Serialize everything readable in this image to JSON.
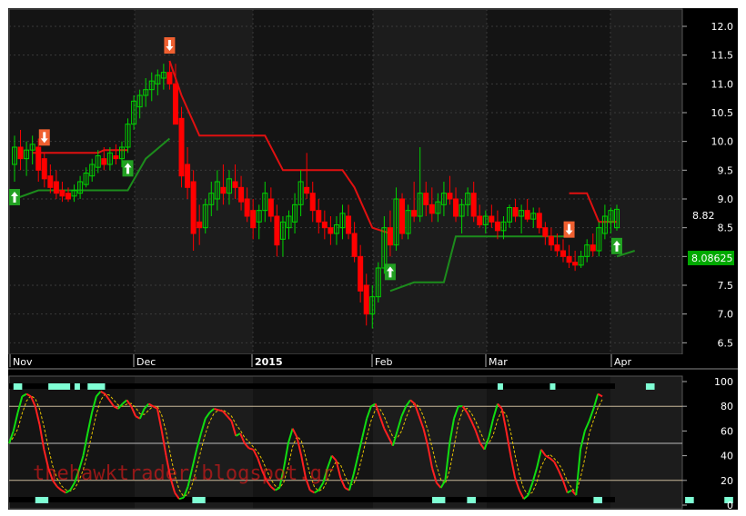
{
  "colors": {
    "background": "#000000",
    "panel_bg_dark": "#141414",
    "panel_bg_light": "#1c1c1c",
    "grid": "#3a3a3a",
    "bull": "#00d400",
    "bear": "#ff0000",
    "stop_up": "#1c8c1c",
    "stop_down": "#e01010",
    "axis_text": "#ffffff",
    "last_price_box": "#00a800",
    "buy_marker": "#22a022",
    "sell_marker": "#f06030",
    "stoch_k_up": "#11dd11",
    "stoch_k_down": "#ff2020",
    "stoch_d": "#e6c200",
    "band_level": "#c8b89a",
    "cyan_marker": "#7fffd4",
    "watermark": "#ff1a1a"
  },
  "x_labels": [
    "Nov",
    "Dec",
    "2015",
    "Feb",
    "Mar",
    "Apr"
  ],
  "watermark_text": "thehawktrader.blogspot.gr",
  "chart_data": [
    {
      "type": "candlestick",
      "title": "",
      "x_range": [
        "Nov 2014",
        "Apr 2015"
      ],
      "y_ticks": [
        6.5,
        7.0,
        7.5,
        8.0,
        8.5,
        9.0,
        9.5,
        10.0,
        10.5,
        11.0,
        11.5,
        12.0
      ],
      "ylim": [
        6.3,
        12.3
      ],
      "last_price": "8.08625",
      "last_high_label": "8.82",
      "grid": true,
      "candles": [
        {
          "o": 9.6,
          "h": 10.1,
          "l": 9.3,
          "c": 9.9
        },
        {
          "o": 9.9,
          "h": 10.2,
          "l": 9.5,
          "c": 9.7
        },
        {
          "o": 9.7,
          "h": 10.0,
          "l": 9.4,
          "c": 9.85
        },
        {
          "o": 9.85,
          "h": 10.1,
          "l": 9.6,
          "c": 9.95
        },
        {
          "o": 9.9,
          "h": 10.05,
          "l": 9.3,
          "c": 9.5
        },
        {
          "o": 9.7,
          "h": 9.8,
          "l": 9.2,
          "c": 9.35
        },
        {
          "o": 9.4,
          "h": 9.6,
          "l": 9.1,
          "c": 9.2
        },
        {
          "o": 9.3,
          "h": 9.5,
          "l": 9.0,
          "c": 9.1
        },
        {
          "o": 9.15,
          "h": 9.3,
          "l": 8.95,
          "c": 9.05
        },
        {
          "o": 9.1,
          "h": 9.2,
          "l": 8.95,
          "c": 9.0
        },
        {
          "o": 9.05,
          "h": 9.25,
          "l": 8.95,
          "c": 9.15
        },
        {
          "o": 9.1,
          "h": 9.4,
          "l": 9.0,
          "c": 9.3
        },
        {
          "o": 9.25,
          "h": 9.55,
          "l": 9.2,
          "c": 9.45
        },
        {
          "o": 9.4,
          "h": 9.7,
          "l": 9.3,
          "c": 9.6
        },
        {
          "o": 9.55,
          "h": 9.85,
          "l": 9.45,
          "c": 9.75
        },
        {
          "o": 9.7,
          "h": 9.9,
          "l": 9.5,
          "c": 9.6
        },
        {
          "o": 9.6,
          "h": 9.9,
          "l": 9.5,
          "c": 9.8
        },
        {
          "o": 9.75,
          "h": 9.95,
          "l": 9.6,
          "c": 9.7
        },
        {
          "o": 9.7,
          "h": 10.0,
          "l": 9.55,
          "c": 9.9
        },
        {
          "o": 9.9,
          "h": 10.4,
          "l": 9.8,
          "c": 10.3
        },
        {
          "o": 10.3,
          "h": 10.8,
          "l": 10.2,
          "c": 10.7
        },
        {
          "o": 10.6,
          "h": 10.9,
          "l": 10.4,
          "c": 10.8
        },
        {
          "o": 10.8,
          "h": 11.1,
          "l": 10.6,
          "c": 10.9
        },
        {
          "o": 10.9,
          "h": 11.2,
          "l": 10.7,
          "c": 11.05
        },
        {
          "o": 11.0,
          "h": 11.25,
          "l": 10.8,
          "c": 11.15
        },
        {
          "o": 11.1,
          "h": 11.35,
          "l": 10.9,
          "c": 11.2
        },
        {
          "o": 11.2,
          "h": 11.4,
          "l": 10.9,
          "c": 11.0
        },
        {
          "o": 11.0,
          "h": 11.35,
          "l": 10.6,
          "c": 10.3
        },
        {
          "o": 10.4,
          "h": 10.6,
          "l": 9.2,
          "c": 9.4
        },
        {
          "o": 9.6,
          "h": 9.9,
          "l": 9.0,
          "c": 9.2
        },
        {
          "o": 9.3,
          "h": 9.5,
          "l": 8.1,
          "c": 8.4
        },
        {
          "o": 8.6,
          "h": 8.9,
          "l": 8.2,
          "c": 8.5
        },
        {
          "o": 8.5,
          "h": 9.0,
          "l": 8.4,
          "c": 8.9
        },
        {
          "o": 8.9,
          "h": 9.3,
          "l": 8.7,
          "c": 9.1
        },
        {
          "o": 9.0,
          "h": 9.5,
          "l": 8.8,
          "c": 9.3
        },
        {
          "o": 9.2,
          "h": 9.6,
          "l": 8.9,
          "c": 9.1
        },
        {
          "o": 9.1,
          "h": 9.5,
          "l": 8.9,
          "c": 9.35
        },
        {
          "o": 9.3,
          "h": 9.6,
          "l": 9.0,
          "c": 9.2
        },
        {
          "o": 9.2,
          "h": 9.4,
          "l": 8.8,
          "c": 8.95
        },
        {
          "o": 9.0,
          "h": 9.2,
          "l": 8.6,
          "c": 8.7
        },
        {
          "o": 8.8,
          "h": 9.0,
          "l": 8.3,
          "c": 8.5
        },
        {
          "o": 8.6,
          "h": 8.9,
          "l": 8.3,
          "c": 8.8
        },
        {
          "o": 8.8,
          "h": 9.3,
          "l": 8.6,
          "c": 9.1
        },
        {
          "o": 9.0,
          "h": 9.2,
          "l": 8.6,
          "c": 8.7
        },
        {
          "o": 8.7,
          "h": 8.9,
          "l": 8.0,
          "c": 8.2
        },
        {
          "o": 8.3,
          "h": 8.7,
          "l": 8.0,
          "c": 8.6
        },
        {
          "o": 8.5,
          "h": 8.8,
          "l": 8.3,
          "c": 8.7
        },
        {
          "o": 8.6,
          "h": 9.1,
          "l": 8.4,
          "c": 8.9
        },
        {
          "o": 8.9,
          "h": 9.5,
          "l": 8.7,
          "c": 9.3
        },
        {
          "o": 9.2,
          "h": 9.8,
          "l": 9.0,
          "c": 9.1
        },
        {
          "o": 9.1,
          "h": 9.3,
          "l": 8.6,
          "c": 8.8
        },
        {
          "o": 8.8,
          "h": 9.0,
          "l": 8.4,
          "c": 8.6
        },
        {
          "o": 8.6,
          "h": 8.8,
          "l": 8.3,
          "c": 8.5
        },
        {
          "o": 8.5,
          "h": 8.7,
          "l": 8.2,
          "c": 8.4
        },
        {
          "o": 8.4,
          "h": 8.7,
          "l": 8.2,
          "c": 8.55
        },
        {
          "o": 8.5,
          "h": 8.9,
          "l": 8.3,
          "c": 8.75
        },
        {
          "o": 8.7,
          "h": 8.9,
          "l": 8.3,
          "c": 8.4
        },
        {
          "o": 8.4,
          "h": 8.6,
          "l": 7.9,
          "c": 8.0
        },
        {
          "o": 8.0,
          "h": 8.2,
          "l": 7.2,
          "c": 7.4
        },
        {
          "o": 7.5,
          "h": 7.7,
          "l": 6.8,
          "c": 7.0
        },
        {
          "o": 7.0,
          "h": 7.5,
          "l": 6.75,
          "c": 7.3
        },
        {
          "o": 7.3,
          "h": 7.9,
          "l": 7.2,
          "c": 7.8
        },
        {
          "o": 7.8,
          "h": 8.7,
          "l": 7.7,
          "c": 8.5
        },
        {
          "o": 8.5,
          "h": 8.8,
          "l": 8.0,
          "c": 8.2
        },
        {
          "o": 8.2,
          "h": 9.2,
          "l": 8.1,
          "c": 9.0
        },
        {
          "o": 9.0,
          "h": 9.1,
          "l": 8.3,
          "c": 8.4
        },
        {
          "o": 8.4,
          "h": 8.9,
          "l": 8.3,
          "c": 8.8
        },
        {
          "o": 8.8,
          "h": 9.3,
          "l": 8.6,
          "c": 8.7
        },
        {
          "o": 8.7,
          "h": 9.9,
          "l": 8.6,
          "c": 9.1
        },
        {
          "o": 9.1,
          "h": 9.3,
          "l": 8.7,
          "c": 8.9
        },
        {
          "o": 8.9,
          "h": 9.2,
          "l": 8.6,
          "c": 8.75
        },
        {
          "o": 8.75,
          "h": 9.1,
          "l": 8.6,
          "c": 8.95
        },
        {
          "o": 8.9,
          "h": 9.3,
          "l": 8.7,
          "c": 9.1
        },
        {
          "o": 9.1,
          "h": 9.4,
          "l": 8.9,
          "c": 9.0
        },
        {
          "o": 9.0,
          "h": 9.2,
          "l": 8.6,
          "c": 8.7
        },
        {
          "o": 8.7,
          "h": 9.0,
          "l": 8.4,
          "c": 8.9
        },
        {
          "o": 8.9,
          "h": 9.2,
          "l": 8.7,
          "c": 9.1
        },
        {
          "o": 9.1,
          "h": 9.3,
          "l": 8.6,
          "c": 8.7
        },
        {
          "o": 8.7,
          "h": 8.9,
          "l": 8.5,
          "c": 8.55
        },
        {
          "o": 8.55,
          "h": 8.8,
          "l": 8.4,
          "c": 8.7
        },
        {
          "o": 8.7,
          "h": 8.9,
          "l": 8.5,
          "c": 8.6
        },
        {
          "o": 8.6,
          "h": 8.8,
          "l": 8.3,
          "c": 8.45
        },
        {
          "o": 8.45,
          "h": 8.7,
          "l": 8.3,
          "c": 8.6
        },
        {
          "o": 8.6,
          "h": 8.9,
          "l": 8.5,
          "c": 8.85
        },
        {
          "o": 8.85,
          "h": 9.0,
          "l": 8.6,
          "c": 8.7
        },
        {
          "o": 8.7,
          "h": 8.9,
          "l": 8.4,
          "c": 8.8
        },
        {
          "o": 8.8,
          "h": 9.0,
          "l": 8.6,
          "c": 8.65
        },
        {
          "o": 8.65,
          "h": 8.85,
          "l": 8.5,
          "c": 8.75
        },
        {
          "o": 8.75,
          "h": 8.85,
          "l": 8.4,
          "c": 8.5
        },
        {
          "o": 8.5,
          "h": 8.6,
          "l": 8.2,
          "c": 8.35
        },
        {
          "o": 8.35,
          "h": 8.5,
          "l": 8.1,
          "c": 8.2
        },
        {
          "o": 8.2,
          "h": 8.4,
          "l": 8.0,
          "c": 8.1
        },
        {
          "o": 8.1,
          "h": 8.3,
          "l": 7.9,
          "c": 8.0
        },
        {
          "o": 8.0,
          "h": 8.2,
          "l": 7.8,
          "c": 7.9
        },
        {
          "o": 7.9,
          "h": 8.1,
          "l": 7.75,
          "c": 7.85
        },
        {
          "o": 7.85,
          "h": 8.1,
          "l": 7.8,
          "c": 8.0
        },
        {
          "o": 8.0,
          "h": 8.3,
          "l": 7.9,
          "c": 8.2
        },
        {
          "o": 8.2,
          "h": 8.4,
          "l": 8.0,
          "c": 8.1
        },
        {
          "o": 8.1,
          "h": 8.6,
          "l": 8.0,
          "c": 8.5
        },
        {
          "o": 8.4,
          "h": 8.9,
          "l": 8.3,
          "c": 8.7
        },
        {
          "o": 8.6,
          "h": 8.85,
          "l": 8.4,
          "c": 8.8
        },
        {
          "o": 8.5,
          "h": 8.9,
          "l": 8.45,
          "c": 8.82
        }
      ],
      "stop_segments": [
        {
          "dir": "up",
          "points": [
            [
              0,
              9.0
            ],
            [
              4,
              9.15
            ],
            [
              19,
              9.15
            ],
            [
              22,
              9.7
            ],
            [
              26,
              10.05
            ]
          ]
        },
        {
          "dir": "down",
          "points": [
            [
              3,
              9.8
            ],
            [
              14,
              9.8
            ],
            [
              15,
              9.85
            ],
            [
              19,
              9.85
            ]
          ]
        },
        {
          "dir": "down",
          "points": [
            [
              26,
              11.4
            ],
            [
              28,
              10.8
            ],
            [
              31,
              10.1
            ],
            [
              42,
              10.1
            ],
            [
              45,
              9.5
            ],
            [
              55,
              9.5
            ],
            [
              57,
              9.2
            ],
            [
              60,
              8.5
            ],
            [
              63,
              8.4
            ]
          ]
        },
        {
          "dir": "up",
          "points": [
            [
              63,
              7.4
            ],
            [
              67,
              7.55
            ],
            [
              72,
              7.55
            ],
            [
              74,
              8.35
            ],
            [
              93,
              8.35
            ]
          ]
        },
        {
          "dir": "down",
          "points": [
            [
              93,
              9.1
            ],
            [
              96,
              9.1
            ],
            [
              98,
              8.6
            ],
            [
              101,
              8.6
            ]
          ]
        },
        {
          "dir": "up",
          "points": [
            [
              101,
              8.0
            ],
            [
              104,
              8.1
            ]
          ]
        }
      ],
      "buy_signals": [
        0,
        19,
        63,
        101
      ],
      "sell_signals": [
        5,
        26,
        93
      ]
    },
    {
      "type": "line",
      "title": "",
      "y_ticks": [
        0,
        20,
        40,
        60,
        80,
        100
      ],
      "ylim": [
        0,
        100
      ],
      "levels": [
        20,
        50,
        80
      ],
      "series": [
        {
          "values": [
            50,
            60,
            75,
            88,
            90,
            88,
            80,
            65,
            45,
            30,
            20,
            15,
            12,
            10,
            12,
            18,
            28,
            40,
            58,
            75,
            88,
            92,
            90,
            85,
            80,
            78,
            82,
            85,
            80,
            72,
            70,
            78,
            82,
            80,
            78,
            60,
            40,
            22,
            10,
            5,
            6,
            15,
            30,
            45,
            58,
            70,
            75,
            78,
            77,
            76,
            72,
            68,
            56,
            58,
            50,
            46,
            45,
            38,
            28,
            20,
            15,
            12,
            14,
            30,
            50,
            62,
            55,
            40,
            22,
            12,
            10,
            12,
            18,
            30,
            40,
            36,
            22,
            14,
            12,
            25,
            40,
            55,
            70,
            80,
            82,
            72,
            62,
            55,
            48,
            60,
            72,
            80,
            85,
            82,
            72,
            62,
            48,
            30,
            18,
            14,
            20,
            50,
            70,
            80,
            80,
            75,
            68,
            60,
            50,
            45,
            55,
            70,
            82,
            78,
            60,
            40,
            22,
            12,
            5,
            8,
            18,
            30,
            45,
            40,
            38,
            35,
            28,
            20,
            10,
            12,
            8,
            45,
            60,
            68,
            78,
            90,
            88
          ]
        }
      ],
      "cyan_top_blocks": [
        [
          1,
          3
        ],
        [
          9,
          14
        ],
        [
          15,
          16
        ],
        [
          18,
          22
        ],
        [
          112,
          113
        ],
        [
          124,
          125
        ],
        [
          146,
          148
        ],
        [
          175,
          176
        ]
      ],
      "cyan_bottom_blocks": [
        [
          6,
          9
        ],
        [
          42,
          45
        ],
        [
          97,
          100
        ],
        [
          105,
          107
        ],
        [
          134,
          136
        ],
        [
          155,
          157
        ],
        [
          164,
          166
        ]
      ]
    }
  ]
}
